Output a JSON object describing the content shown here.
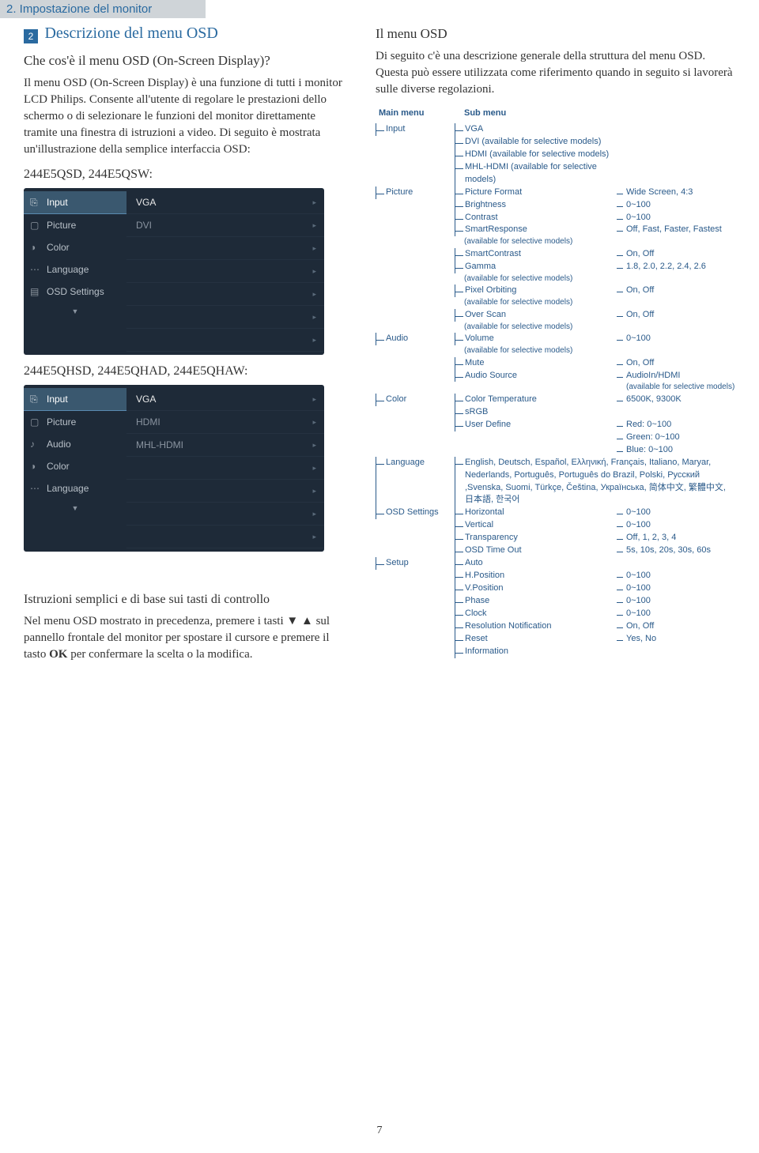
{
  "header": "2. Impostazione del monitor",
  "badge": "2",
  "title": "Descrizione del menu OSD",
  "q1": "Che cos'è il menu OSD (On-Screen Display)?",
  "p1": "Il menu OSD (On-Screen Display) è una funzione di tutti i monitor LCD Philips. Consente all'utente di regolare le prestazioni dello schermo o di selezionare le funzioni del monitor direttamente tramite una finestra di istruzioni a video. Di seguito è mostrata un'illustrazione della semplice interfaccia OSD:",
  "model1": "244E5QSD, 244E5QSW:",
  "model2": "244E5QHSD, 244E5QHAD, 244E5QHAW:",
  "osd1": {
    "left": [
      "Input",
      "Picture",
      "Color",
      "Language",
      "OSD Settings"
    ],
    "right": [
      "VGA",
      "DVI"
    ]
  },
  "osd2": {
    "left": [
      "Input",
      "Picture",
      "Audio",
      "Color",
      "Language"
    ],
    "right": [
      "VGA",
      "HDMI",
      "MHL-HDMI"
    ]
  },
  "instr_h": "Istruzioni semplici e di base sui tasti di controllo",
  "instr_p_a": "Nel menu OSD mostrato in precedenza, premere i tasti ",
  "instr_p_b": " sul pannello frontale del monitor per spostare il cursore e premere il tasto ",
  "instr_p_c": " per confermare la scelta o la modifica.",
  "instr_arrows": "▼ ▲",
  "instr_ok": "OK",
  "right_h": "Il menu OSD",
  "right_p": "Di seguito c'è una descrizione generale della struttura del menu OSD. Questa può essere utilizzata come riferimento quando in seguito si lavorerà sulle diverse regolazioni.",
  "tree": {
    "main_h": "Main menu",
    "sub_h": "Sub menu",
    "input": {
      "name": "Input",
      "items": [
        "VGA",
        "DVI (available for selective models)",
        "HDMI (available for selective models)",
        "MHL-HDMI (available for selective models)"
      ]
    },
    "picture": {
      "name": "Picture",
      "rows": [
        {
          "l": "Picture Format",
          "r": "Wide Screen, 4:3"
        },
        {
          "l": "Brightness",
          "r": "0~100"
        },
        {
          "l": "Contrast",
          "r": "0~100"
        },
        {
          "l": "SmartResponse",
          "r": "Off, Fast, Faster, Fastest"
        },
        {
          "note": "(available for selective models)"
        },
        {
          "l": "SmartContrast",
          "r": "On, Off"
        },
        {
          "l": "Gamma",
          "r": "1.8, 2.0, 2.2, 2.4, 2.6"
        },
        {
          "note": "(available for selective models)"
        },
        {
          "l": "Pixel Orbiting",
          "r": "On, Off"
        },
        {
          "note": "(available for selective models)"
        },
        {
          "l": "Over Scan",
          "r": "On, Off"
        },
        {
          "note": "(available for selective models)"
        }
      ]
    },
    "audio": {
      "name": "Audio",
      "rows": [
        {
          "l": "Volume",
          "r": "0~100"
        },
        {
          "note": "(available for selective models)"
        },
        {
          "l": "Mute",
          "r": "On, Off"
        },
        {
          "l": "Audio Source",
          "r": "AudioIn/HDMI"
        },
        {
          "note2": "(available for selective models)"
        }
      ]
    },
    "color": {
      "name": "Color",
      "rows": [
        {
          "l": "Color Temperature",
          "r": "6500K, 9300K"
        },
        {
          "l": "sRGB",
          "r": ""
        },
        {
          "l": "User Define",
          "r": "Red: 0~100"
        },
        {
          "l": "",
          "r": "Green: 0~100"
        },
        {
          "l": "",
          "r": "Blue: 0~100"
        }
      ]
    },
    "language": {
      "name": "Language",
      "text": "English, Deutsch, Español, Ελληνική, Français, Italiano, Maryar, Nederlands, Português, Português do Brazil, Polski, Русский ,Svenska, Suomi, Türkçe, Čeština, Українська, 简体中文, 繁體中文, 日本語, 한국어"
    },
    "osd_settings": {
      "name": "OSD Settings",
      "rows": [
        {
          "l": "Horizontal",
          "r": "0~100"
        },
        {
          "l": "Vertical",
          "r": "0~100"
        },
        {
          "l": "Transparency",
          "r": "Off, 1, 2, 3, 4"
        },
        {
          "l": "OSD Time Out",
          "r": "5s, 10s, 20s, 30s, 60s"
        }
      ]
    },
    "setup": {
      "name": "Setup",
      "rows": [
        {
          "l": "Auto",
          "r": ""
        },
        {
          "l": "H.Position",
          "r": "0~100"
        },
        {
          "l": "V.Position",
          "r": "0~100"
        },
        {
          "l": "Phase",
          "r": "0~100"
        },
        {
          "l": "Clock",
          "r": "0~100"
        },
        {
          "l": "Resolution Notification",
          "r": "On, Off"
        },
        {
          "l": "Reset",
          "r": "Yes, No"
        },
        {
          "l": "Information",
          "r": ""
        }
      ]
    }
  },
  "page_num": "7"
}
